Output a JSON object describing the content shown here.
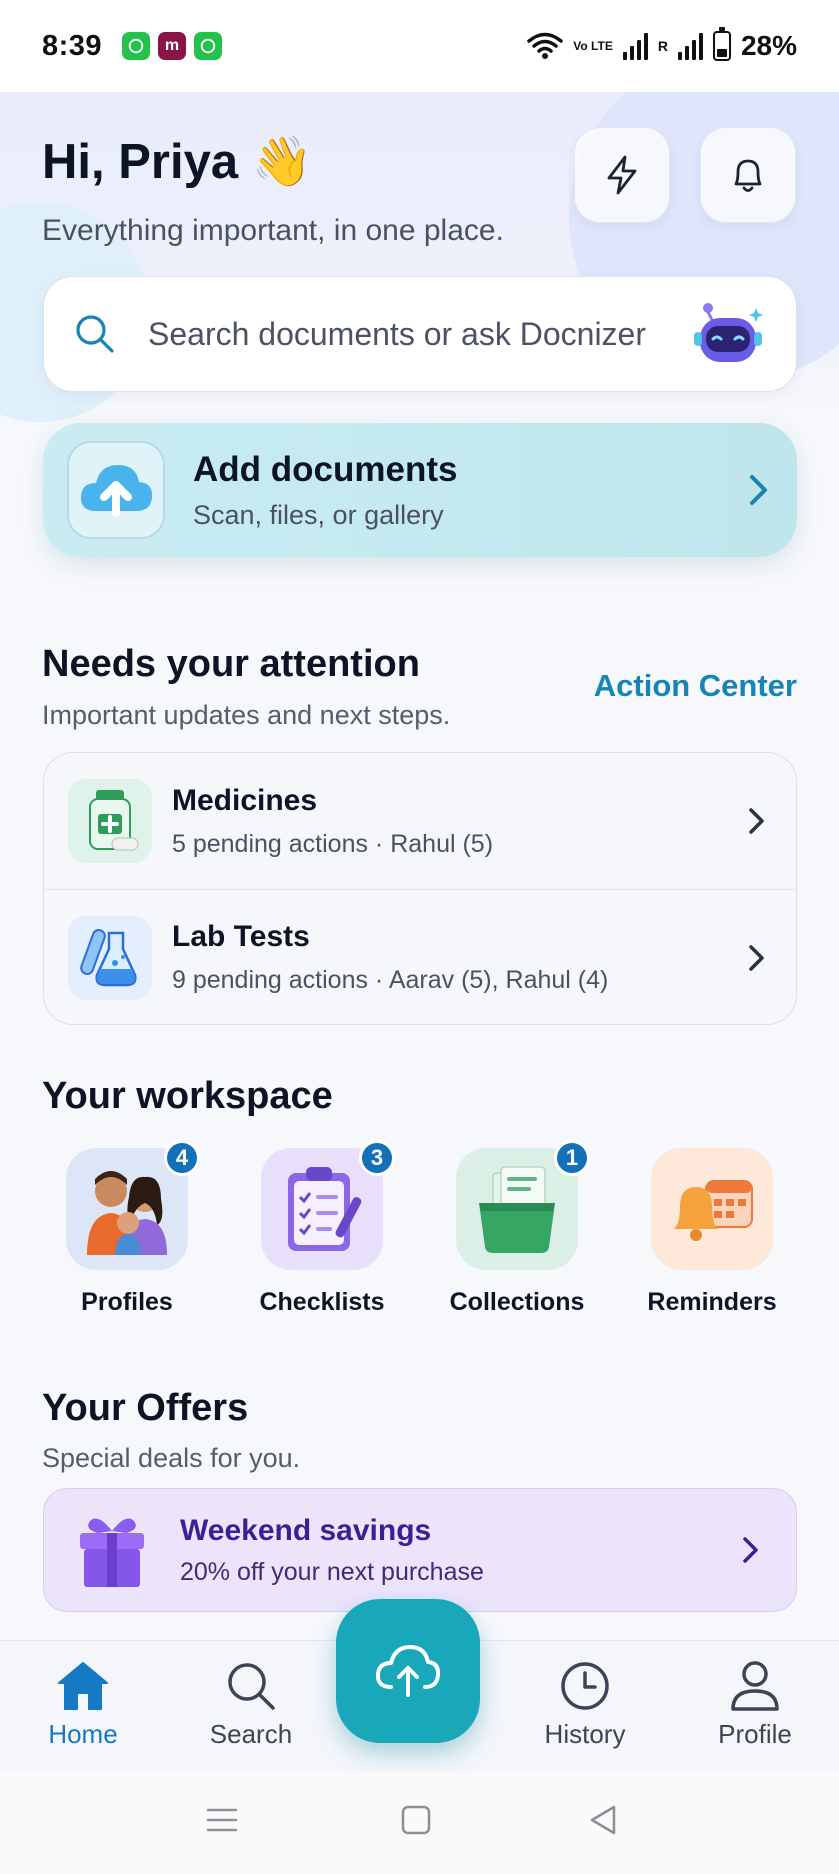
{
  "status_bar": {
    "time": "8:39",
    "volte": "Vo LTE",
    "roaming": "R",
    "battery": "28%"
  },
  "header": {
    "greeting": "Hi, Priya 👋",
    "subtitle": "Everything important, in one place."
  },
  "search": {
    "placeholder": "Search documents or ask Docnizer"
  },
  "add_documents": {
    "title": "Add documents",
    "subtitle": "Scan, files, or gallery"
  },
  "attention": {
    "title": "Needs your attention",
    "subtitle": "Important updates and next steps.",
    "link": "Action Center",
    "items": [
      {
        "title": "Medicines",
        "subtitle": "5 pending actions · Rahul (5)"
      },
      {
        "title": "Lab Tests",
        "subtitle": "9 pending actions · Aarav (5), Rahul (4)"
      }
    ]
  },
  "workspace": {
    "title": "Your workspace",
    "items": [
      {
        "label": "Profiles",
        "badge": "4"
      },
      {
        "label": "Checklists",
        "badge": "3"
      },
      {
        "label": "Collections",
        "badge": "1"
      },
      {
        "label": "Reminders",
        "badge": ""
      }
    ]
  },
  "offers": {
    "title": "Your Offers",
    "subtitle": "Special deals for you.",
    "card": {
      "title": "Weekend savings",
      "subtitle": "20% off your next purchase"
    }
  },
  "bottom_nav": {
    "items": [
      {
        "label": "Home",
        "icon": "home-icon",
        "active": true
      },
      {
        "label": "Search",
        "icon": "search-icon",
        "active": false
      },
      {
        "label": "History",
        "icon": "clock-icon",
        "active": false
      },
      {
        "label": "Profile",
        "icon": "user-icon",
        "active": false
      }
    ],
    "fab_icon": "cloud-upload-icon"
  },
  "colors": {
    "accent": "#1685b5",
    "fab": "#18a8ba",
    "offer_text": "#3b1f94",
    "badge": "#1471b8"
  }
}
